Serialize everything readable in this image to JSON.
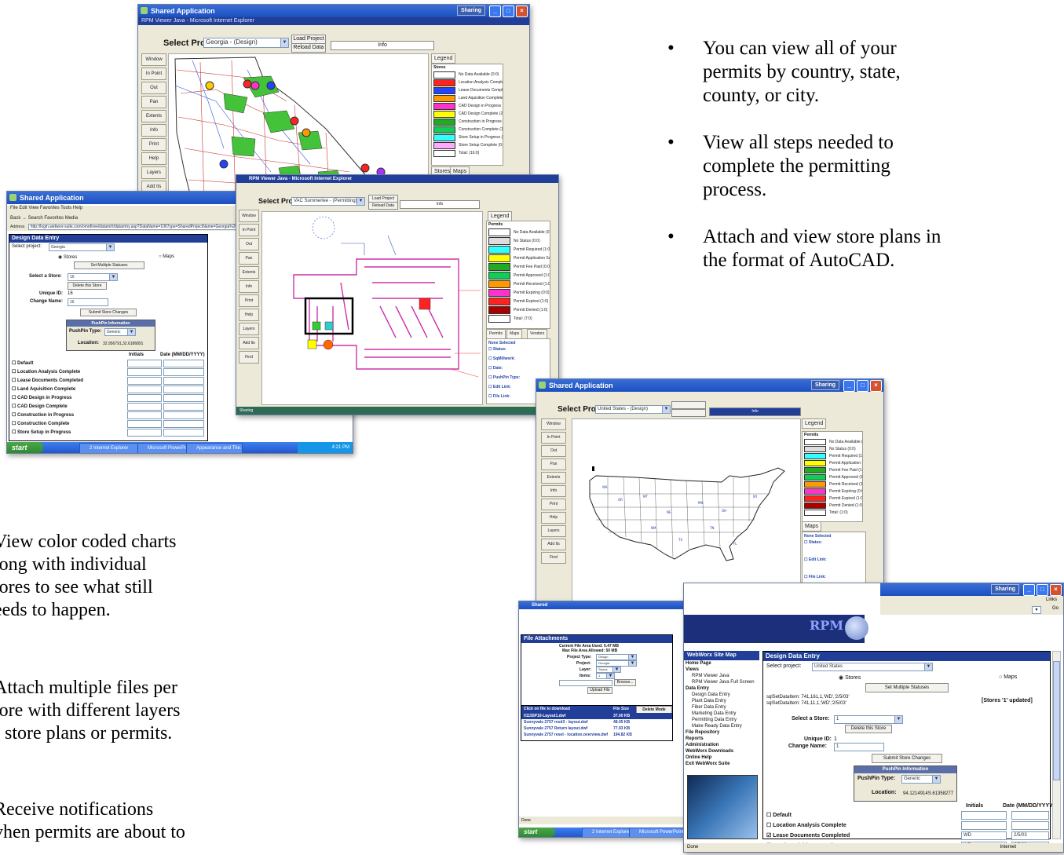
{
  "bullets_right": [
    {
      "lines": [
        "You can view all of your",
        "permits by country, state,",
        "county, or city."
      ]
    },
    {
      "lines": [
        "View all steps needed to",
        "complete the permitting",
        "process."
      ]
    },
    {
      "lines": [
        "Attach and view store plans in",
        "the format of AutoCAD."
      ]
    }
  ],
  "left_paragraphs": [
    {
      "lines": [
        "View color coded charts",
        "long with individual",
        "tores to see what still",
        "eeds to happen."
      ]
    },
    {
      "lines": [
        "Attach multiple files per",
        "tore with different layers",
        "f store plans or permits."
      ]
    },
    {
      "lines": [
        "Receive notifications",
        "vhen permits are about to"
      ]
    }
  ],
  "win_georgia": {
    "title": "Shared Application",
    "subtitle": "RPM Viewer Java - Microsoft Internet Explorer",
    "sharing": "Sharing",
    "select_project_label": "Select Project:",
    "project": "Georgia - (Design)",
    "load_project": "Load Project",
    "reload_data": "Reload Data",
    "status": "Info",
    "side_buttons": [
      "Window",
      "In Point",
      "Out",
      "Pan",
      "Extents",
      "Info",
      "Print",
      "Help",
      "Layers",
      "Add Its",
      "Find"
    ],
    "legend_tab": "Legend",
    "legend_header": "Stores",
    "legend": [
      {
        "color": "#ffffff",
        "label": "No Data Available (0:0)"
      },
      {
        "color": "#ff2222",
        "label": "Location Analysis Complete"
      },
      {
        "color": "#2244ff",
        "label": "Lease Documents Complete"
      },
      {
        "color": "#ff9900",
        "label": "Land Aquisition Complete ("
      },
      {
        "color": "#ff33cc",
        "label": "CAD Design in Progress (2"
      },
      {
        "color": "#ffff00",
        "label": "CAD Design Complete (2:"
      },
      {
        "color": "#22aa22",
        "label": "Construction in Progress ("
      },
      {
        "color": "#11cc55",
        "label": "Construction Complete (1:"
      },
      {
        "color": "#33ffff",
        "label": "Store Setup in Progress (0"
      },
      {
        "color": "#ffaaff",
        "label": "Store Setup Complete (0:0"
      },
      {
        "color": "#ffffff",
        "label": "Total: (16:0)"
      }
    ],
    "bottom_tabs": [
      "Stores",
      "Maps"
    ]
  },
  "win_design_left": {
    "title": "Shared Application",
    "menu": "File  Edit  View  Favorites  Tools  Help",
    "toolbar": "Back  →  Search  Favorites  Media",
    "address_label": "Address",
    "address": "http://login.webwor-suite.com/omrdtree/datam/rt/datarntry.asp?DataName=1067ype=SharedProjectName=Georgia%20",
    "panel_title": "Design Data Entry",
    "select_project_label": "Select project:",
    "select_project": "Georgia",
    "radio_stores": "Stores",
    "radio_maps": "Maps",
    "set_multiple": "Set Multiple Statuses",
    "select_store_label": "Select a Store:",
    "select_store": "16",
    "delete_store": "Delete this Store",
    "unique_id_label": "Unique ID:",
    "unique_id": "16",
    "change_name_label": "Change Name:",
    "change_name": "16",
    "submit": "Submit Store Changes",
    "pushpin_info": "PushPin Information",
    "pushpin_type_label": "PushPin Type:",
    "pushpin_type": "Generic",
    "location_label": "Location:",
    "location": "32.956791,32.6186891",
    "col_initials": "Initials",
    "col_date": "Date (MM/DD/YYYY)",
    "statuses": [
      "Default",
      "Location Analysis Complete",
      "Lease Documents Completed",
      "Land Aquisition Complete",
      "CAD Design in Progress",
      "CAD Design Complete",
      "Construction in Progress",
      "Construction Complete",
      "Store Setup in Progress"
    ],
    "start": "start",
    "tasks": [
      "2 Internet Explorer",
      "Microsoft PowerPoint ...",
      "Appearance and The..."
    ],
    "clock": "4:21 PM"
  },
  "win_floorplan": {
    "title": "RPM Viewer Java - Microsoft Internet Explorer",
    "select_project_label": "Select Project:",
    "project": "VAC Summerlee - (Permitting)",
    "load_project": "Load Project",
    "reload_data": "Reload Data",
    "status": "Info",
    "side_buttons": [
      "Window",
      "In Point",
      "Out",
      "Pan",
      "Extents",
      "Info",
      "Print",
      "Help",
      "Layers",
      "Add Its",
      "Find"
    ],
    "legend_tab": "Legend",
    "legend_header": "Permits",
    "legend": [
      {
        "color": "#ffffff",
        "label": "No Data Available (0:0)"
      },
      {
        "color": "#dddddd",
        "label": "No Status (0:0)"
      },
      {
        "color": "#33ffff",
        "label": "Permit Required (1:0)"
      },
      {
        "color": "#ffff00",
        "label": "Permit Application Submitte"
      },
      {
        "color": "#22aa22",
        "label": "Permit Fee Paid (0:0)"
      },
      {
        "color": "#11cc55",
        "label": "Permit Approved (1:0)"
      },
      {
        "color": "#ff9900",
        "label": "Permit Received (1:0)"
      },
      {
        "color": "#ff33cc",
        "label": "Permit Expiring (0:0)"
      },
      {
        "color": "#ff2222",
        "label": "Permit Expired (1:0)"
      },
      {
        "color": "#aa0000",
        "label": "Permit Denied (1:0)"
      },
      {
        "color": "#ffffff",
        "label": "Total: (7:0)"
      }
    ],
    "tabs": [
      "Permits",
      "Maps",
      "Vendors"
    ],
    "info_header": "None Selected",
    "info_items": [
      "Status:",
      "SqMillwork:",
      "Date:",
      "PushPin Type:",
      "Edit Link:",
      "File Link:"
    ],
    "footer": "Sharing"
  },
  "win_usa": {
    "title": "Shared Application",
    "sharing": "Sharing",
    "select_project_label": "Select Project:",
    "project": "United States - (Design)",
    "status": "Info",
    "side_buttons": [
      "Window",
      "In Point",
      "Out",
      "Pan",
      "Extents",
      "Info",
      "Print",
      "Help",
      "Layers",
      "Add Its",
      "Find"
    ],
    "legend_tab": "Legend",
    "legend_header": "Permits",
    "legend": [
      {
        "color": "#ffffff",
        "label": "No Data Available (0:0)"
      },
      {
        "color": "#dddddd",
        "label": "No Status (0:0)"
      },
      {
        "color": "#33ffff",
        "label": "Permit Required (1:0)"
      },
      {
        "color": "#ffff00",
        "label": "Permit Application Submitte"
      },
      {
        "color": "#22aa22",
        "label": "Permit Fee Paid (1:0)"
      },
      {
        "color": "#11cc55",
        "label": "Permit Approved (1:0)"
      },
      {
        "color": "#ff9900",
        "label": "Permit Received (1:0)"
      },
      {
        "color": "#ff33cc",
        "label": "Permit Expiring (0:0)"
      },
      {
        "color": "#ff2222",
        "label": "Permit Expired (1:0)"
      },
      {
        "color": "#aa0000",
        "label": "Permit Denied (1:0)"
      },
      {
        "color": "#ffffff",
        "label": "Total: (1:0)"
      }
    ],
    "tab": "Maps",
    "info_header": "None Selected",
    "info_items": [
      "Status:",
      "Edit Link:",
      "File Link:"
    ],
    "start": "start",
    "tasks": [
      "2 Internet Explorer",
      "Microsoft PowerPoint ...",
      "Appearance and The..."
    ],
    "clock": "5:28 PM"
  },
  "win_files": {
    "title": "Shared",
    "panel_title": "File Attachments",
    "current_area": "Current File Area Used: 0.47 MB",
    "max_area": "Max File Area Allowed: 50 MB",
    "project_type_label": "Project Type:",
    "project_type": "Design",
    "project_label": "Project:",
    "project": "Georgia",
    "layer_label": "Layer:",
    "layer": "Stores",
    "items_label": "Items:",
    "items": "1",
    "browse": "Browse...",
    "upload": "Upload File",
    "col_file": "Click on file to download",
    "col_size": "File Size",
    "delete_mode": "Delete Mode",
    "files": [
      {
        "name": "01155P10-Layout1.dwf",
        "size": "37.00 KB"
      },
      {
        "name": "Sunnyvale 2757 revd3 - layout.dwf",
        "size": "48.05 KB"
      },
      {
        "name": "Sunnyvale 2757 Return layout.dwf",
        "size": "77.93 KB"
      },
      {
        "name": "Sunnyvale 2757 reset - location.overview.dwf",
        "size": "194.82 KB"
      }
    ],
    "status_bar": "Done",
    "start": "start",
    "tasks": [
      "2 Internet Explorer",
      "Microsoft PowerPoint ..."
    ]
  },
  "win_webworx": {
    "sharing": "Sharing",
    "links": "Links",
    "go": "Go",
    "logo_text": "RPM",
    "sitemap_title": "WebWorx Site Map",
    "sitemap": [
      {
        "text": "Home Page",
        "bold": true
      },
      {
        "text": "Views",
        "bold": true
      },
      {
        "text": "RPM Viewer Java",
        "bold": false
      },
      {
        "text": "RPM Viewer Java Full Screen",
        "bold": false
      },
      {
        "text": "Data Entry",
        "bold": true
      },
      {
        "text": "Design Data Entry",
        "bold": false
      },
      {
        "text": "Plant Data Entry",
        "bold": false
      },
      {
        "text": "Fiber Data Entry",
        "bold": false
      },
      {
        "text": "Marketing Data Entry",
        "bold": false
      },
      {
        "text": "Permitting Data Entry",
        "bold": false
      },
      {
        "text": "Make Ready Data Entry",
        "bold": false
      },
      {
        "text": "File Repository",
        "bold": true
      },
      {
        "text": "Reports",
        "bold": true
      },
      {
        "text": "Administration",
        "bold": true
      },
      {
        "text": "WebWorx Downloads",
        "bold": true
      },
      {
        "text": "Online Help",
        "bold": true
      },
      {
        "text": "Exit WebWorx Suite",
        "bold": true
      }
    ],
    "panel_title": "Design Data Entry",
    "select_project_label": "Select project:",
    "select_project": "United States",
    "radio_stores": "Stores",
    "radio_maps": "Maps",
    "set_multiple": "Set Multiple Statuses",
    "sql_lines": [
      "sqlSetDataItem: 741,161,1,'WD','2/5/03'",
      "sqlSetDataItem: 741,11,1,'WD','2/5/03'"
    ],
    "stores_updated": "[Stores '1' updated]",
    "select_store_label": "Select a Store:",
    "select_store": "1",
    "delete_store": "Delete this Store",
    "unique_id_label": "Unique ID:",
    "unique_id": "1",
    "change_name_label": "Change Name:",
    "change_name": "1",
    "submit": "Submit Store Changes",
    "pushpin_info": "PushPin Information",
    "pushpin_type_label": "PushPin Type:",
    "pushpin_type": "Generic",
    "location_label": "Location:",
    "location": "94.1214914S.61358277",
    "col_initials": "Initials",
    "col_date": "Date (MM/DD/YYYY)",
    "statuses": [
      {
        "label": "Default",
        "checked": false,
        "initials": "",
        "date": ""
      },
      {
        "label": "Location Analysis Complete",
        "checked": false,
        "initials": "",
        "date": ""
      },
      {
        "label": "Lease Documents Completed",
        "checked": true,
        "initials": "WD",
        "date": "2/5/03"
      },
      {
        "label": "Land Aquisition Complete",
        "checked": true,
        "initials": "WD",
        "date": "2/5/03"
      },
      {
        "label": "CAD Design in Progress",
        "checked": true,
        "initials": "WD",
        "date": "2/5/03"
      }
    ],
    "status_left": "Done",
    "status_right": "Internet"
  }
}
